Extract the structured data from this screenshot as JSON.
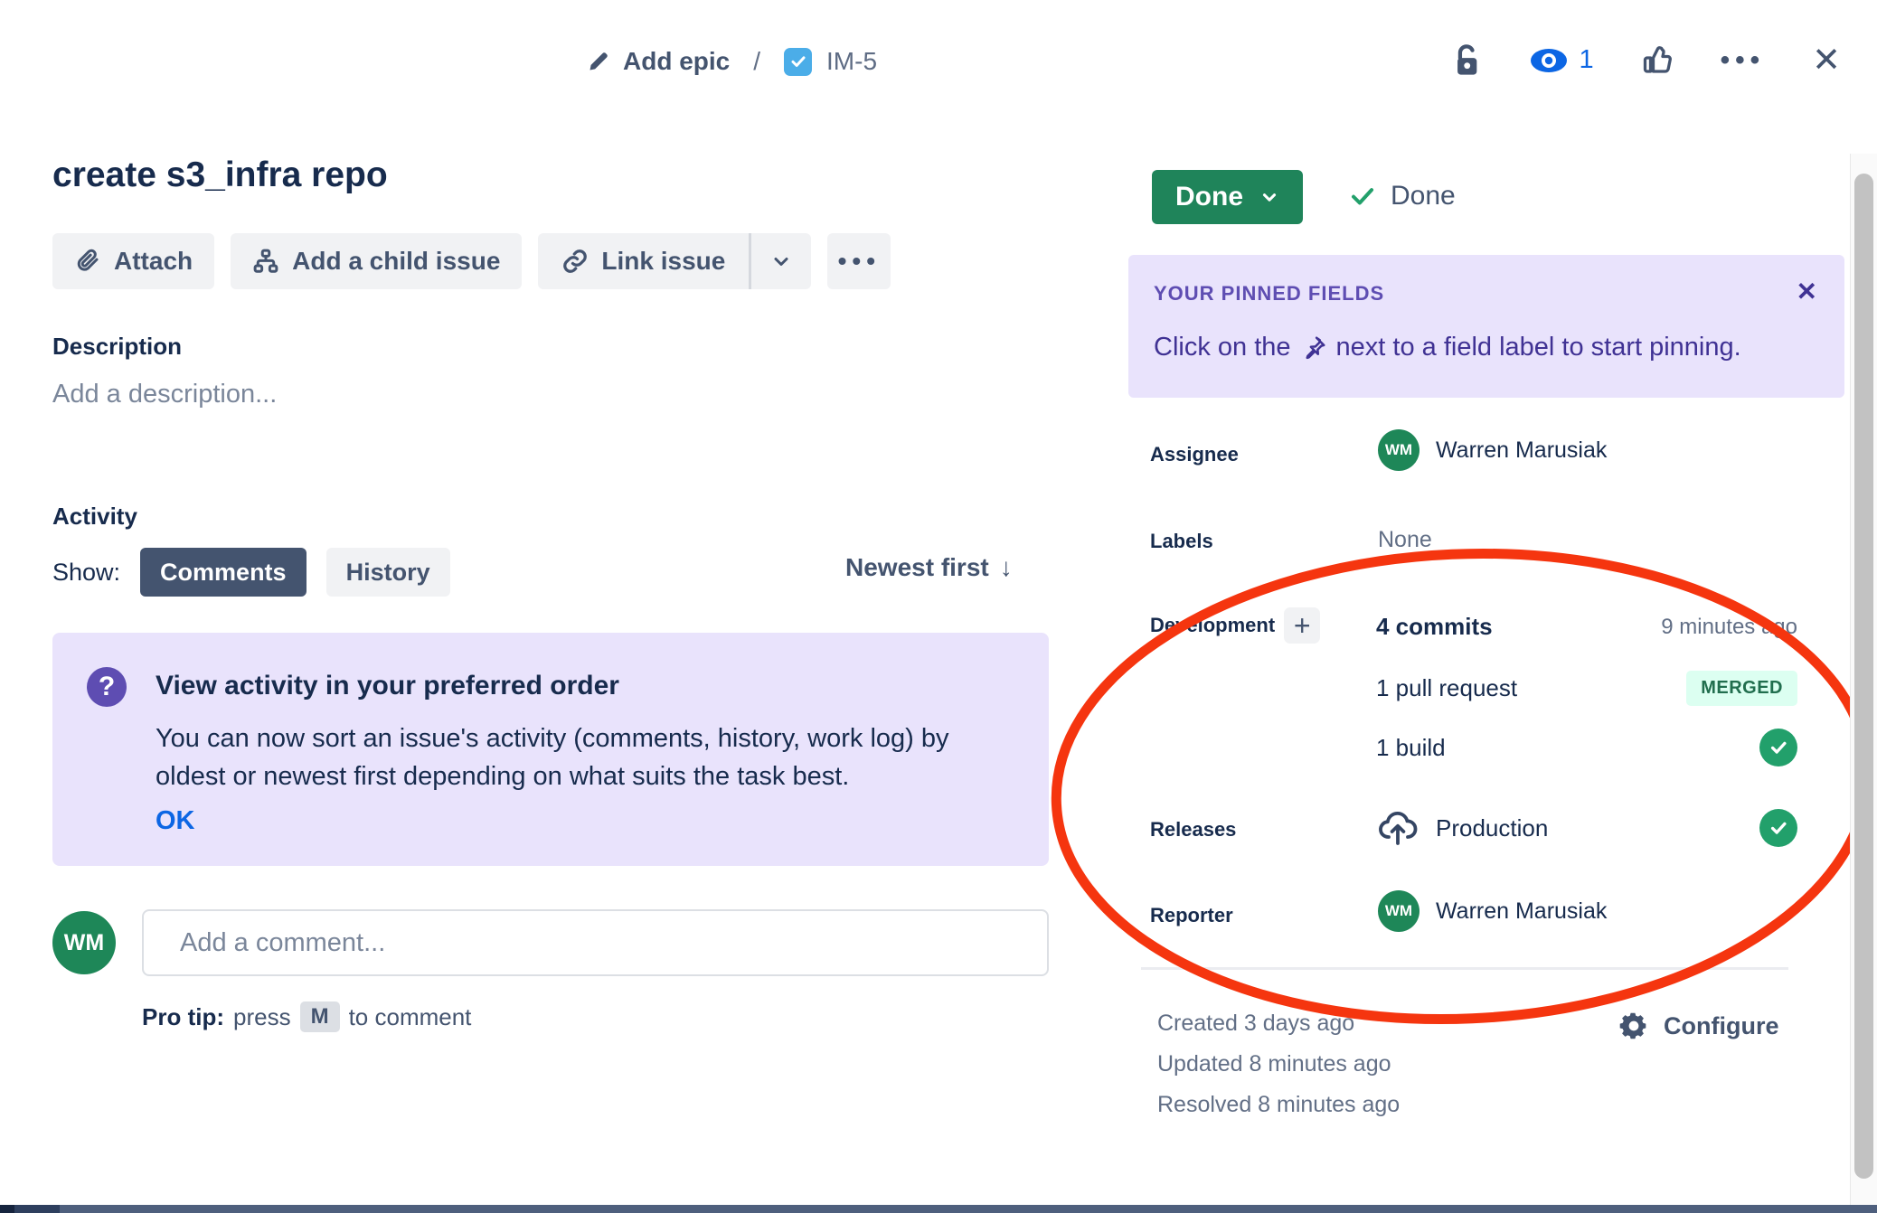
{
  "header": {
    "breadcrumb": {
      "epic_label": "Add epic",
      "separator": "/",
      "issue_key": "IM-5"
    },
    "watchers_count": "1"
  },
  "issue": {
    "title": "create s3_infra repo"
  },
  "toolbar": {
    "attach_label": "Attach",
    "add_child_label": "Add a child issue",
    "link_issue_label": "Link issue"
  },
  "description": {
    "heading": "Description",
    "placeholder": "Add a description..."
  },
  "activity": {
    "heading": "Activity",
    "show_label": "Show:",
    "tabs": [
      {
        "label": "Comments"
      },
      {
        "label": "History"
      }
    ],
    "sort_label": "Newest first"
  },
  "tip_banner": {
    "title": "View activity in your preferred order",
    "body": "You can now sort an issue's activity (comments, history, work log) by oldest or newest first depending on what suits the task best.",
    "ok_label": "OK"
  },
  "comment": {
    "avatar_initials": "WM",
    "placeholder": "Add a comment...",
    "pro_tip_bold": "Pro tip:",
    "pro_tip_pre": "press",
    "key": "M",
    "pro_tip_post": "to comment"
  },
  "status": {
    "button_label": "Done",
    "resolution_label": "Done"
  },
  "pinned": {
    "heading": "YOUR PINNED FIELDS",
    "body_pre": "Click on the",
    "body_post": "next to a field label to start pinning."
  },
  "fields": {
    "assignee": {
      "label": "Assignee",
      "value": "Warren Marusiak",
      "initials": "WM"
    },
    "labels": {
      "label": "Labels",
      "value": "None"
    },
    "development": {
      "label": "Development",
      "rows": [
        {
          "text": "4 commits",
          "meta": "9 minutes ago"
        },
        {
          "text": "1 pull request",
          "badge": "MERGED"
        },
        {
          "text": "1 build"
        }
      ]
    },
    "releases": {
      "label": "Releases",
      "value": "Production"
    },
    "reporter": {
      "label": "Reporter",
      "value": "Warren Marusiak",
      "initials": "WM"
    }
  },
  "footer": {
    "created": "Created 3 days ago",
    "updated": "Updated 8 minutes ago",
    "resolved": "Resolved 8 minutes ago",
    "configure_label": "Configure"
  },
  "glyphs": {
    "ellipsis": "•••",
    "close": "✕",
    "arrow_down": "↓",
    "plus": "+",
    "question": "?"
  },
  "colors": {
    "accent_blue": "#0C66E4",
    "task_blue": "#4BADE8",
    "purple_bg": "#E9E3FC",
    "purple_text": "#403294",
    "green_button": "#1F845A",
    "green_check": "#22A06B",
    "avatar_green": "#1E8758",
    "merged_bg": "#DCFFF1",
    "merged_text": "#216E4E",
    "annotation_red": "#F5350F"
  }
}
